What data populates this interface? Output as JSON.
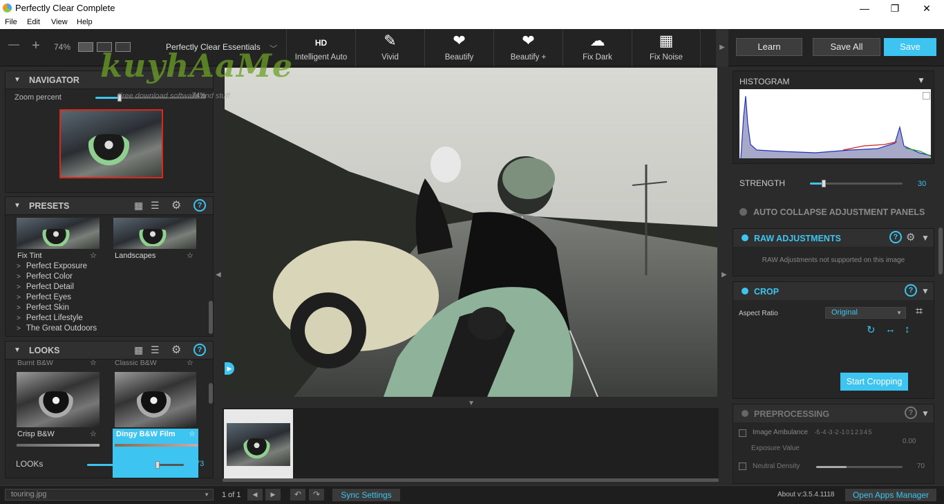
{
  "window": {
    "title": "Perfectly Clear Complete",
    "min": "—",
    "max": "❐",
    "close": "✕"
  },
  "menu": [
    "File",
    "Edit",
    "View",
    "Help"
  ],
  "toolbar": {
    "zoom_out": "—",
    "zoom_in": "+",
    "zoom": "74%",
    "preset_name": "Perfectly Clear Essentials",
    "tools": [
      {
        "label": "Intelligent Auto",
        "icon": "hd-brush-icon",
        "glyph": "HD"
      },
      {
        "label": "Vivid",
        "icon": "brush-icon",
        "glyph": "✎"
      },
      {
        "label": "Beautify",
        "icon": "beautify-icon",
        "glyph": "❤"
      },
      {
        "label": "Beautify +",
        "icon": "beautify-plus-icon",
        "glyph": "❤"
      },
      {
        "label": "Fix Dark",
        "icon": "cloud-icon",
        "glyph": "☁"
      },
      {
        "label": "Fix Noise",
        "icon": "noise-icon",
        "glyph": "▦"
      }
    ],
    "learn": "Learn",
    "save_all": "Save All",
    "save": "Save"
  },
  "navigator": {
    "title": "NAVIGATOR",
    "zoom_label": "Zoom percent",
    "zoom_value": "74%",
    "zoom_fraction": 0.22
  },
  "presets": {
    "title": "PRESETS",
    "thumbs": [
      "Fix Tint",
      "Landscapes"
    ],
    "items": [
      "Perfect Exposure",
      "Perfect Color",
      "Perfect Detail",
      "Perfect Eyes",
      "Perfect Skin",
      "Perfect Lifestyle",
      "The Great Outdoors"
    ]
  },
  "looks": {
    "title": "LOOKS",
    "top_labels": [
      "Burnt B&W",
      "Classic B&W"
    ],
    "thumbs": [
      "Crisp B&W",
      "Dingy B&W Film"
    ],
    "slider_label": "LOOKs",
    "slider_value": "73",
    "slider_fraction": 0.73
  },
  "watermark": {
    "brand": "kuyhAaMe",
    "sub": "Free download software and stuff"
  },
  "histogram": {
    "title": "HISTOGRAM"
  },
  "strength": {
    "label": "STRENGTH",
    "value": "30",
    "fraction": 0.15
  },
  "auto_collapse": "AUTO COLLAPSE ADJUSTMENT PANELS",
  "raw": {
    "title": "RAW ADJUSTMENTS",
    "msg": "RAW Adjustments not supported on this image"
  },
  "crop": {
    "title": "CROP",
    "aspect_label": "Aspect Ratio",
    "aspect_value": "Original",
    "start": "Start Cropping"
  },
  "preprocessing": {
    "title": "PREPROCESSING",
    "ambulance": "Image Ambulance",
    "exposure": "Exposure Value",
    "exposure_val": "0.00",
    "ticks": "-5 -4 -3 -2 -1 0 1 2 3 4 5",
    "neutral": "Neutral Density",
    "neutral_val": "70",
    "neutral_fraction": 0.35
  },
  "status": {
    "file": "touring.jpg",
    "page": "1 of 1",
    "sync": "Sync Settings",
    "about": "About v:3.5.4.1118",
    "open_apps": "Open Apps Manager"
  },
  "colors": {
    "accent": "#3ec4f0",
    "panel": "#262626",
    "bg": "#2b2b2b"
  }
}
